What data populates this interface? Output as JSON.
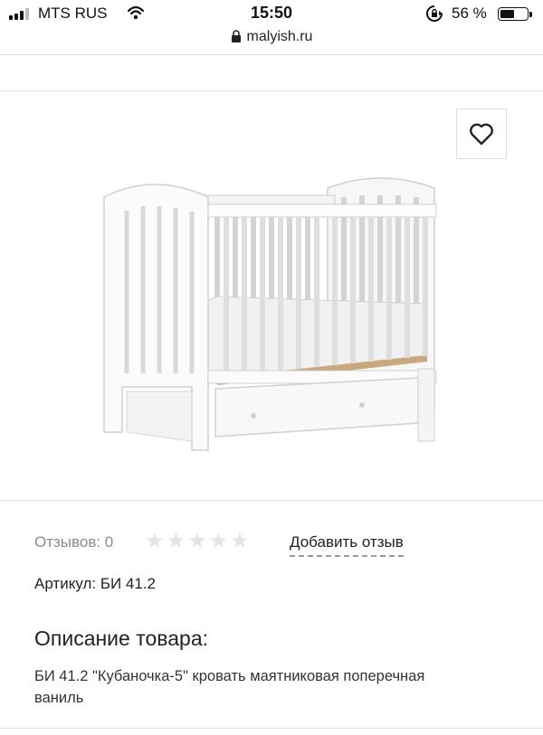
{
  "status_bar": {
    "carrier": "MTS RUS",
    "time": "15:50",
    "battery_percent": "56 %",
    "battery_level": 0.56
  },
  "browser": {
    "url": "malyish.ru"
  },
  "product": {
    "favorite_icon": "heart-outline-icon",
    "reviews_label": "Отзывов: 0",
    "rating": 0,
    "rating_max": 5,
    "add_review_label": "Добавить отзыв",
    "article_label": "Артикул: БИ 41.2",
    "description_heading": "Описание товара:",
    "description_text": "БИ 41.2 \"Кубаночка-5\" кровать маятниковая поперечная ваниль"
  },
  "colors": {
    "text": "#222222",
    "muted_text": "#8c8c8c",
    "star_inactive": "#e4e4e4",
    "divider": "#e2e2e2"
  }
}
